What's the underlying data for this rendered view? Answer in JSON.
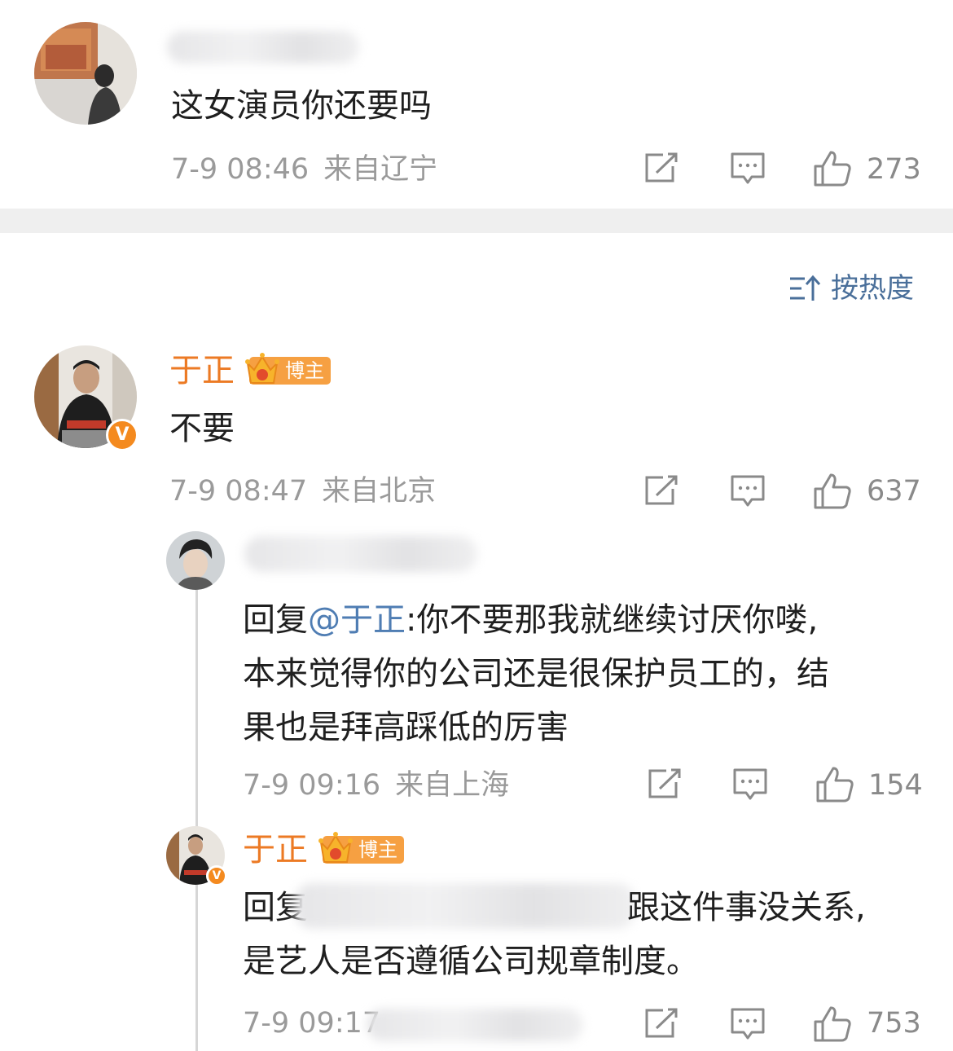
{
  "comments": [
    {
      "text": "这女演员你还要吗",
      "date": "7-9 08:46",
      "location": "来自辽宁",
      "likes": "273"
    }
  ],
  "sort": {
    "label": "按热度"
  },
  "main_reply": {
    "author": "于正",
    "badge": "博主",
    "text": "不要",
    "date": "7-9 08:47",
    "location": "来自北京",
    "likes": "637"
  },
  "sub_replies": [
    {
      "text_prefix": "回复",
      "mention": "@于正",
      "text_lines": [
        ":你不要那我就继续讨厌你喽,",
        "本来觉得你的公司还是很保护员工的，结",
        "果也是拜高踩低的厉害"
      ],
      "date": "7-9 09:16",
      "location": "来自上海",
      "likes": "154"
    },
    {
      "author": "于正",
      "badge": "博主",
      "text_prefix": "回复",
      "text_line1_rest": "跟这件事没关系,",
      "text_line2": "是艺人是否遵循公司规章制度。",
      "date": "7-9 09:17",
      "likes": "753"
    }
  ],
  "icons": [
    "share-icon",
    "comment-icon",
    "like-icon",
    "sort-icon",
    "crown-icon",
    "verified-icon"
  ],
  "colors": {
    "accent": "#ec7a24",
    "mention": "#4f7db3",
    "meta": "#9a9a9a",
    "badge": "#f6a042"
  }
}
